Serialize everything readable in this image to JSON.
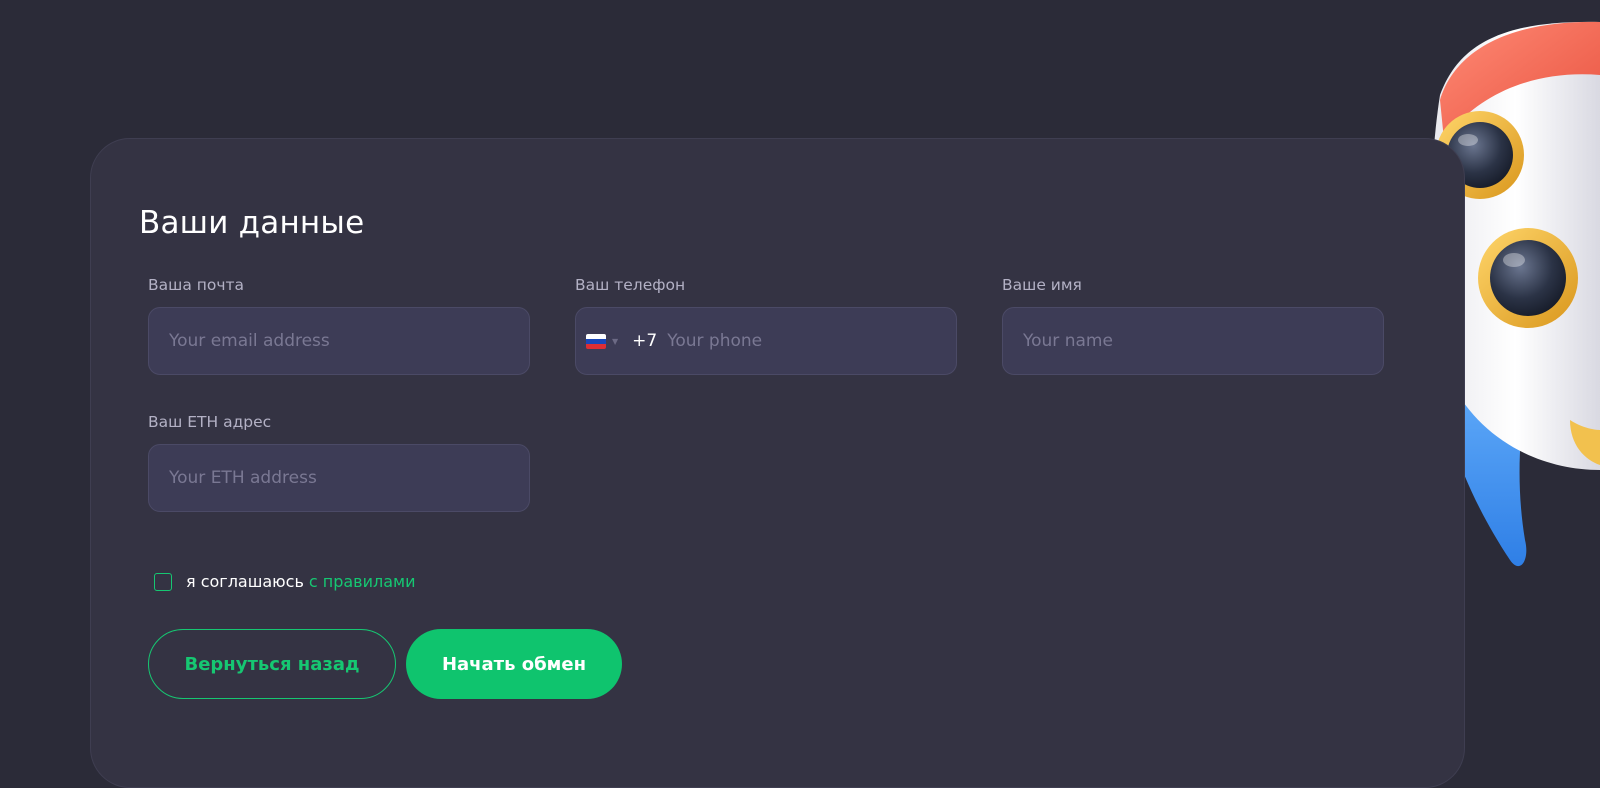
{
  "form": {
    "title": "Ваши данные",
    "email": {
      "label": "Ваша почта",
      "placeholder": "Your email address",
      "value": ""
    },
    "phone": {
      "label": "Ваш телефон",
      "country_flag": "ru-flag-icon",
      "dial_code": "+7",
      "placeholder": "Your phone",
      "value": ""
    },
    "name": {
      "label": "Ваше имя",
      "placeholder": "Your name",
      "value": ""
    },
    "eth": {
      "label": "Ваш ETH адрес",
      "placeholder": "Your ETH address",
      "value": ""
    },
    "agreement": {
      "text": "я соглашаюсь",
      "link": "с правилами",
      "checked": false
    },
    "buttons": {
      "back": "Вернуться назад",
      "start": "Начать обмен"
    }
  },
  "colors": {
    "page_background": "#2b2b38",
    "card_background": "#343343",
    "input_background": "#3d3c56",
    "accent": "#16c772",
    "text_primary": "#ffffff",
    "label_text": "#b3b1c5",
    "placeholder_text": "#7a7893"
  },
  "decoration": {
    "icon": "rocket-icon"
  }
}
